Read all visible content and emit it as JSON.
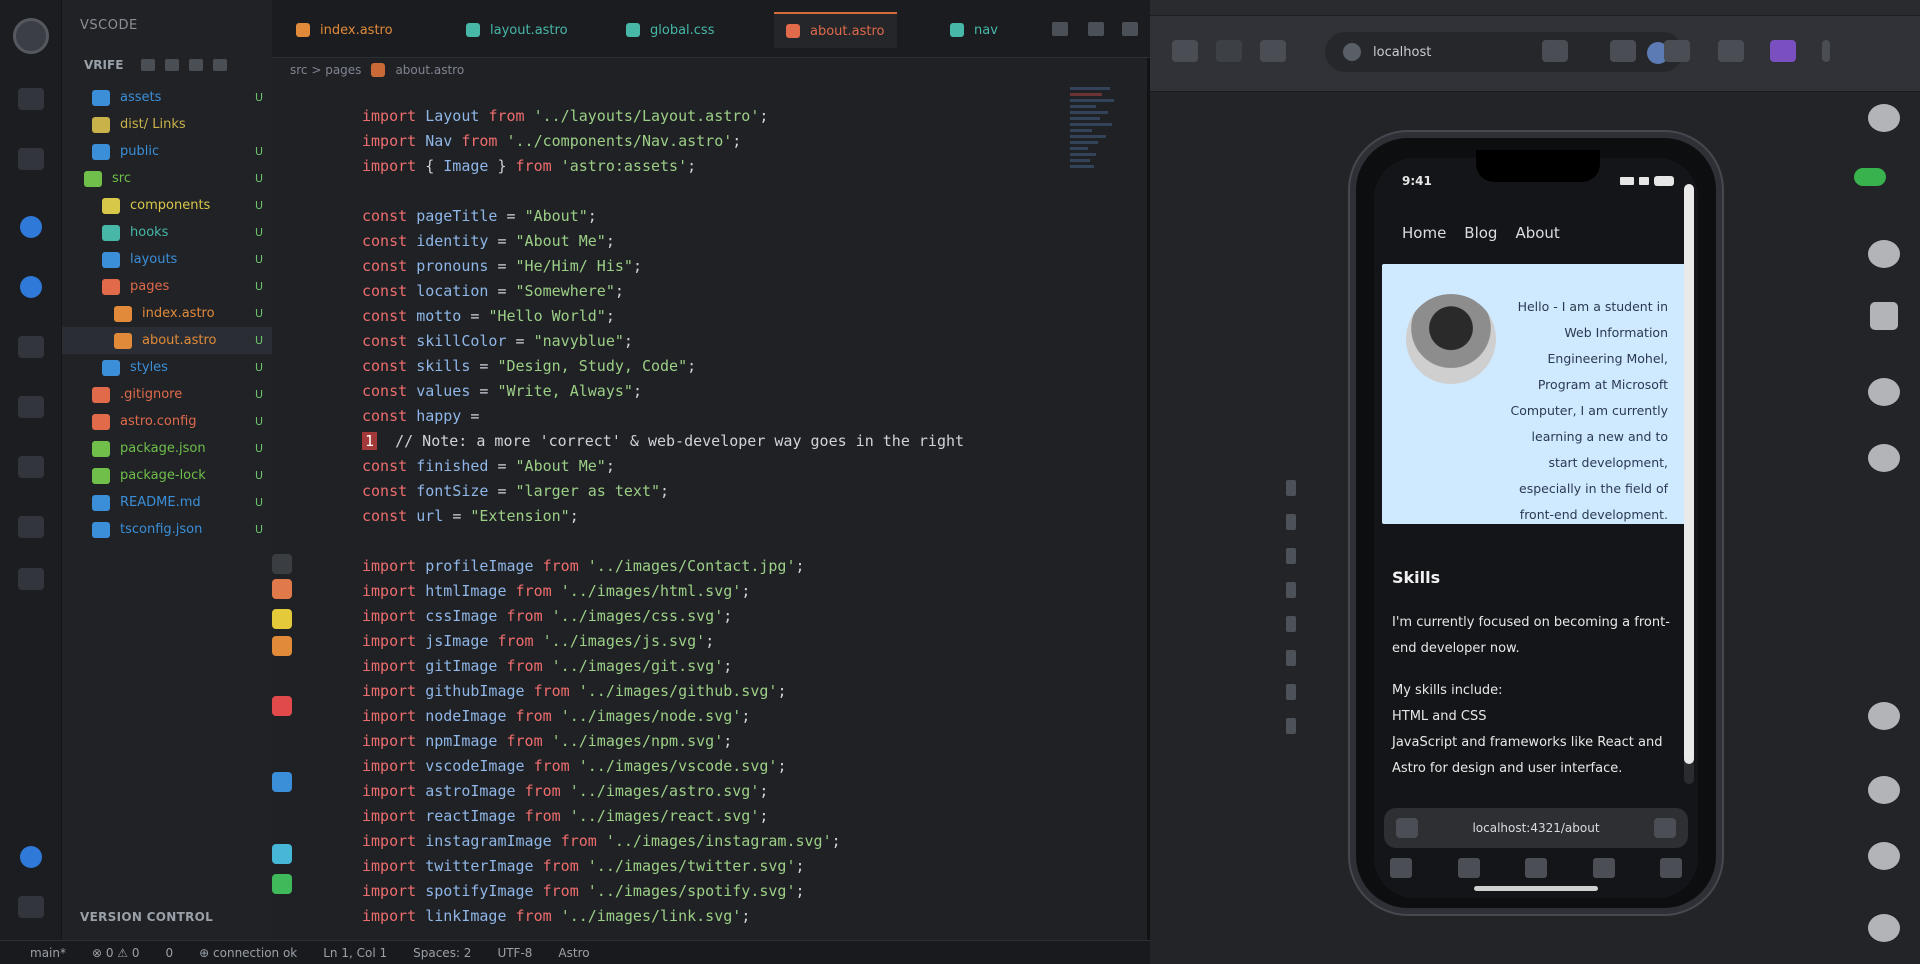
{
  "explorer": {
    "header": "VSCODE",
    "toolbar_label": "VRIFE",
    "footer_label": "VERSION CONTROL",
    "items": [
      {
        "label": "assets",
        "color": "#3b8fd8",
        "status": "U",
        "indent": 30
      },
      {
        "label": "dist/ Links",
        "color": "#c9b24a",
        "status": "",
        "indent": 30
      },
      {
        "label": "public",
        "color": "#3b8fd8",
        "status": "U",
        "indent": 30
      },
      {
        "label": "src",
        "color": "#6fbf4a",
        "status": "U",
        "indent": 22
      },
      {
        "label": "components",
        "color": "#d8c84a",
        "status": "U",
        "indent": 40
      },
      {
        "label": "hooks",
        "color": "#47b7a8",
        "status": "U",
        "indent": 40
      },
      {
        "label": "layouts",
        "color": "#3b8fd8",
        "status": "U",
        "indent": 40
      },
      {
        "label": "pages",
        "color": "#e06a4a",
        "status": "U",
        "indent": 40
      },
      {
        "label": "index.astro",
        "color": "#e08a3a",
        "status": "U",
        "indent": 52
      },
      {
        "label": "about.astro",
        "color": "#e08a3a",
        "status": "U",
        "indent": 52
      },
      {
        "label": "styles",
        "color": "#3b8fd8",
        "status": "U",
        "indent": 40
      },
      {
        "label": ".gitignore",
        "color": "#e06a4a",
        "status": "U",
        "indent": 30
      },
      {
        "label": "astro.config",
        "color": "#e06a4a",
        "status": "U",
        "indent": 30
      },
      {
        "label": "package.json",
        "color": "#6fbf4a",
        "status": "U",
        "indent": 30
      },
      {
        "label": "package-lock",
        "color": "#6fbf4a",
        "status": "U",
        "indent": 30
      },
      {
        "label": "README.md",
        "color": "#3b8fd8",
        "status": "U",
        "indent": 30
      },
      {
        "label": "tsconfig.json",
        "color": "#3b8fd8",
        "status": "U",
        "indent": 30
      }
    ]
  },
  "tabs": [
    {
      "label": "index.astro",
      "color": "#e08a3a",
      "active": false
    },
    {
      "label": "layout.astro",
      "color": "#47b7a8",
      "active": false
    },
    {
      "label": "global.css",
      "color": "#47b7a8",
      "active": false
    },
    {
      "label": "about.astro",
      "color": "#e06a4a",
      "active": true
    },
    {
      "label": "nav",
      "color": "#47b7a8",
      "active": false
    }
  ],
  "breadcrumb": {
    "part1": "src > pages",
    "part2": "about.astro"
  },
  "code_lines": [
    [
      [
        "kw",
        "import "
      ],
      [
        "id",
        "Layout "
      ],
      [
        "kw",
        "from "
      ],
      [
        "str",
        "'../layouts/Layout.astro'"
      ],
      [
        "pun",
        ";"
      ]
    ],
    [
      [
        "kw",
        "import "
      ],
      [
        "id",
        "Nav "
      ],
      [
        "kw",
        "from "
      ],
      [
        "str",
        "'../components/Nav.astro'"
      ],
      [
        "pun",
        ";"
      ]
    ],
    [
      [
        "kw",
        "import "
      ],
      [
        "pun",
        "{ "
      ],
      [
        "id",
        "Image "
      ],
      [
        "pun",
        "} "
      ],
      [
        "kw",
        "from "
      ],
      [
        "str",
        "'astro:assets'"
      ],
      [
        "pun",
        ";"
      ]
    ],
    [
      [
        "pun",
        ""
      ]
    ],
    [
      [
        "kw",
        "const "
      ],
      [
        "id",
        "pageTitle "
      ],
      [
        "pun",
        "= "
      ],
      [
        "str",
        "\"About\""
      ],
      [
        "pun",
        ";"
      ]
    ],
    [
      [
        "kw",
        "const "
      ],
      [
        "id",
        "identity "
      ],
      [
        "pun",
        "= "
      ],
      [
        "str",
        "\"About Me\""
      ],
      [
        "pun",
        ";"
      ]
    ],
    [
      [
        "kw",
        "const "
      ],
      [
        "id",
        "pronouns "
      ],
      [
        "pun",
        "= "
      ],
      [
        "str",
        "\"He/Him/ His\""
      ],
      [
        "pun",
        ";"
      ]
    ],
    [
      [
        "kw",
        "const "
      ],
      [
        "id",
        "location "
      ],
      [
        "pun",
        "= "
      ],
      [
        "str",
        "\"Somewhere\""
      ],
      [
        "pun",
        ";"
      ]
    ],
    [
      [
        "kw",
        "const "
      ],
      [
        "id",
        "motto "
      ],
      [
        "pun",
        "= "
      ],
      [
        "str",
        "\"Hello World\""
      ],
      [
        "pun",
        ";"
      ]
    ],
    [
      [
        "kw",
        "const "
      ],
      [
        "id",
        "skillColor "
      ],
      [
        "pun",
        "= "
      ],
      [
        "str",
        "\"navyblue\""
      ],
      [
        "pun",
        ";"
      ]
    ],
    [
      [
        "kw",
        "const "
      ],
      [
        "id",
        "skills "
      ],
      [
        "pun",
        "= "
      ],
      [
        "str",
        "\"Design, Study, Code\""
      ],
      [
        "pun",
        ";"
      ]
    ],
    [
      [
        "kw",
        "const "
      ],
      [
        "id",
        "values "
      ],
      [
        "pun",
        "= "
      ],
      [
        "str",
        "\"Write, Always\""
      ],
      [
        "pun",
        ";"
      ]
    ],
    [
      [
        "kw",
        "const "
      ],
      [
        "id",
        "happy "
      ],
      [
        "pun",
        "= "
      ]
    ],
    [
      [
        "err",
        "1"
      ],
      [
        "pun",
        "  // Note: a more 'correct' & web-developer way goes in the right"
      ]
    ],
    [
      [
        "kw",
        "const "
      ],
      [
        "id",
        "finished "
      ],
      [
        "pun",
        "= "
      ],
      [
        "str",
        "\"About Me\""
      ],
      [
        "pun",
        ";"
      ]
    ],
    [
      [
        "kw",
        "const "
      ],
      [
        "id",
        "fontSize "
      ],
      [
        "pun",
        "= "
      ],
      [
        "str",
        "\"larger as text\""
      ],
      [
        "pun",
        ";"
      ]
    ],
    [
      [
        "kw",
        "const "
      ],
      [
        "id",
        "url "
      ],
      [
        "pun",
        "= "
      ],
      [
        "str",
        "\"Extension\""
      ],
      [
        "pun",
        ";"
      ]
    ],
    [
      [
        "pun",
        ""
      ]
    ],
    [
      [
        "kw",
        "import "
      ],
      [
        "id",
        "profileImage "
      ],
      [
        "kw",
        "from "
      ],
      [
        "str",
        "'../images/Contact.jpg'"
      ],
      [
        "pun",
        ";"
      ]
    ],
    [
      [
        "kw",
        "import "
      ],
      [
        "id",
        "htmlImage "
      ],
      [
        "kw",
        "from "
      ],
      [
        "str",
        "'../images/html.svg'"
      ],
      [
        "pun",
        ";"
      ]
    ],
    [
      [
        "kw",
        "import "
      ],
      [
        "id",
        "cssImage "
      ],
      [
        "kw",
        "from "
      ],
      [
        "str",
        "'../images/css.svg'"
      ],
      [
        "pun",
        ";"
      ]
    ],
    [
      [
        "kw",
        "import "
      ],
      [
        "id",
        "jsImage "
      ],
      [
        "kw",
        "from "
      ],
      [
        "str",
        "'../images/js.svg'"
      ],
      [
        "pun",
        ";"
      ]
    ],
    [
      [
        "kw",
        "import "
      ],
      [
        "id",
        "gitImage "
      ],
      [
        "kw",
        "from "
      ],
      [
        "str",
        "'../images/git.svg'"
      ],
      [
        "pun",
        ";"
      ]
    ],
    [
      [
        "kw",
        "import "
      ],
      [
        "id",
        "githubImage "
      ],
      [
        "kw",
        "from "
      ],
      [
        "str",
        "'../images/github.svg'"
      ],
      [
        "pun",
        ";"
      ]
    ],
    [
      [
        "kw",
        "import "
      ],
      [
        "id",
        "nodeImage "
      ],
      [
        "kw",
        "from "
      ],
      [
        "str",
        "'../images/node.svg'"
      ],
      [
        "pun",
        ";"
      ]
    ],
    [
      [
        "kw",
        "import "
      ],
      [
        "id",
        "npmImage "
      ],
      [
        "kw",
        "from "
      ],
      [
        "str",
        "'../images/npm.svg'"
      ],
      [
        "pun",
        ";"
      ]
    ],
    [
      [
        "kw",
        "import "
      ],
      [
        "id",
        "vscodeImage "
      ],
      [
        "kw",
        "from "
      ],
      [
        "str",
        "'../images/vscode.svg'"
      ],
      [
        "pun",
        ";"
      ]
    ],
    [
      [
        "kw",
        "import "
      ],
      [
        "id",
        "astroImage "
      ],
      [
        "kw",
        "from "
      ],
      [
        "str",
        "'../images/astro.svg'"
      ],
      [
        "pun",
        ";"
      ]
    ],
    [
      [
        "kw",
        "import "
      ],
      [
        "id",
        "reactImage "
      ],
      [
        "kw",
        "from "
      ],
      [
        "str",
        "'../images/react.svg'"
      ],
      [
        "pun",
        ";"
      ]
    ],
    [
      [
        "kw",
        "import "
      ],
      [
        "id",
        "instagramImage "
      ],
      [
        "kw",
        "from "
      ],
      [
        "str",
        "'../images/instagram.svg'"
      ],
      [
        "pun",
        ";"
      ]
    ],
    [
      [
        "kw",
        "import "
      ],
      [
        "id",
        "twitterImage "
      ],
      [
        "kw",
        "from "
      ],
      [
        "str",
        "'../images/twitter.svg'"
      ],
      [
        "pun",
        ";"
      ]
    ],
    [
      [
        "kw",
        "import "
      ],
      [
        "id",
        "spotifyImage "
      ],
      [
        "kw",
        "from "
      ],
      [
        "str",
        "'../images/spotify.svg'"
      ],
      [
        "pun",
        ";"
      ]
    ],
    [
      [
        "kw",
        "import "
      ],
      [
        "id",
        "linkImage "
      ],
      [
        "kw",
        "from "
      ],
      [
        "str",
        "'../images/link.svg'"
      ],
      [
        "pun",
        ";"
      ]
    ]
  ],
  "status": {
    "branch": "main*",
    "errors": "⊗ 0  ⚠ 0",
    "ports": "0",
    "center": "⊕ connection ok",
    "position": "Ln 1, Col 1",
    "spaces": "Spaces: 2",
    "encoding": "UTF-8",
    "lang": "Astro"
  },
  "simulator": {
    "url": "localhost",
    "phone": {
      "time": "9:41",
      "nav_links": [
        "Home",
        "Blog",
        "About"
      ],
      "card_text": "Hello - I am a student in Web Information Engineering Mohel, Program at Microsoft Computer, I am currently learning a new and to start development, especially in the field of front-end development.",
      "section_title": "Skills",
      "para1": "I'm currently focused on becoming a front-end developer now.",
      "para2": "My skills include:\nHTML and CSS\nJavaScript and frameworks like React and Astro for design and user interface.",
      "url_bar": "localhost:4321/about"
    }
  }
}
